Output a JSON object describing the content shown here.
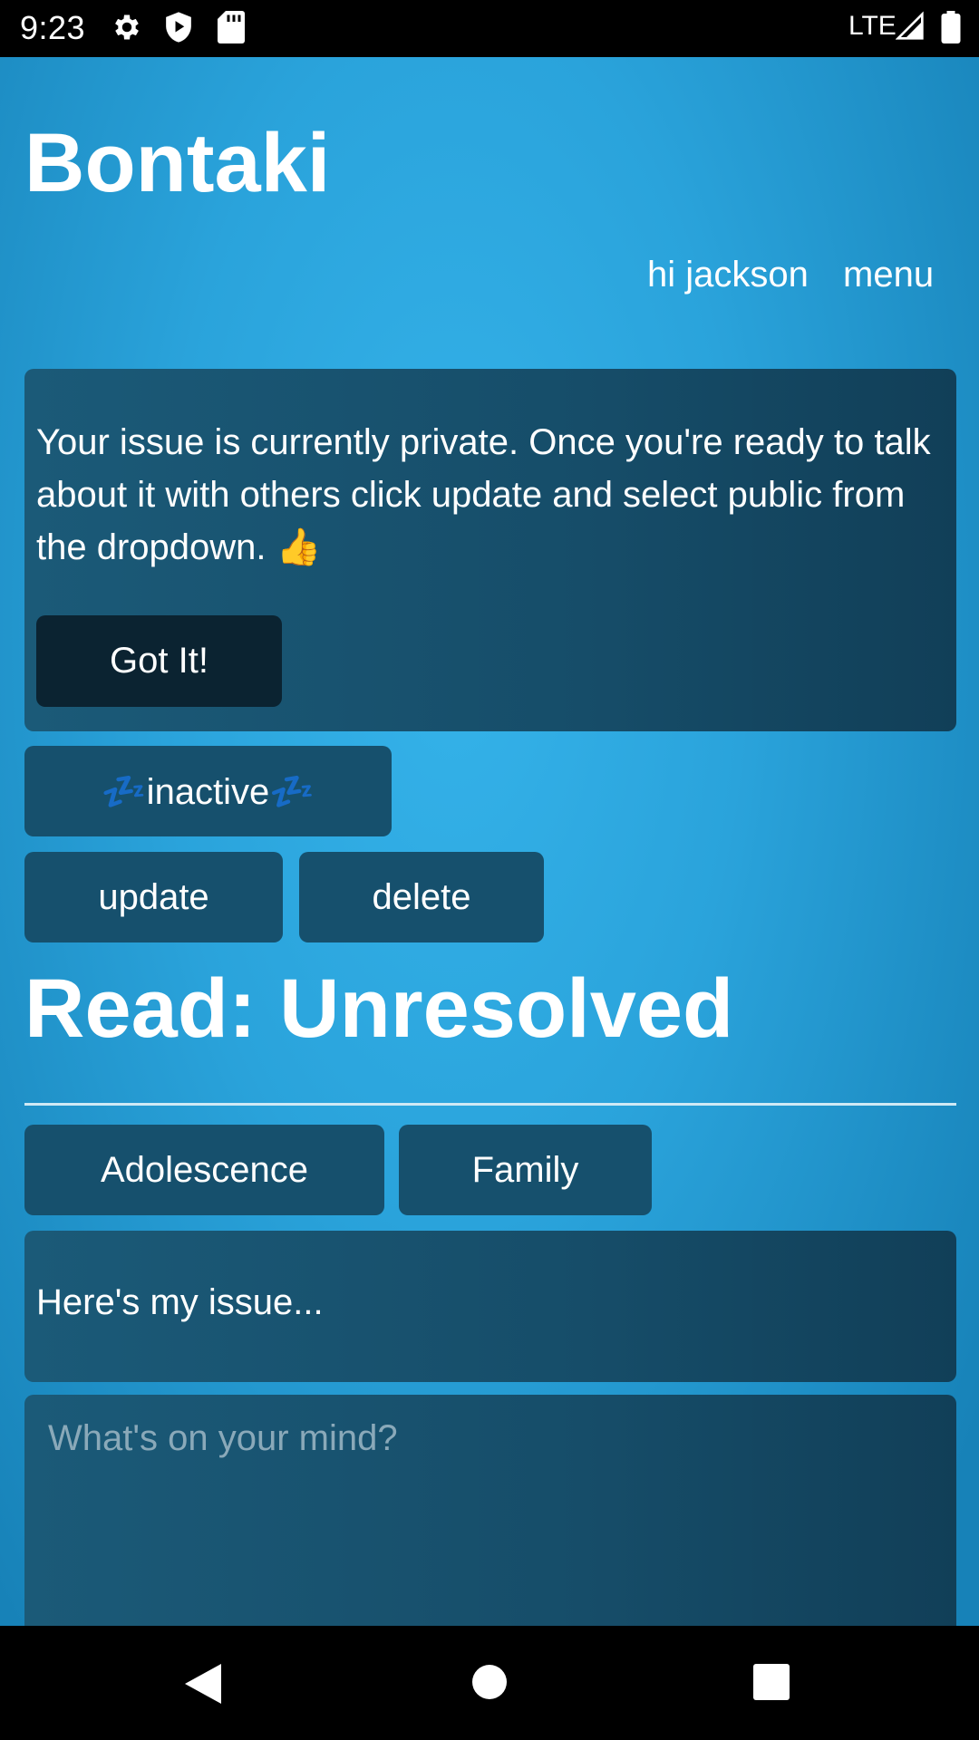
{
  "status_bar": {
    "time": "9:23",
    "network": "LTE",
    "icons": [
      "settings-gear-icon",
      "shield-play-icon",
      "sd-card-icon",
      "signal-icon",
      "battery-icon"
    ]
  },
  "header": {
    "app_title": "Bontaki",
    "greeting": "hi jackson",
    "menu_label": "menu"
  },
  "notice": {
    "text": "Your issue is currently private. Once you're ready to talk about it with others click update and select public from the dropdown. 👍",
    "button_label": "Got It!"
  },
  "status": {
    "badge_label": "💤inactive💤"
  },
  "actions": {
    "update_label": "update",
    "delete_label": "delete"
  },
  "issue": {
    "heading": "Read: Unresolved",
    "tags": [
      "Adolescence",
      "Family"
    ],
    "body": "Here's my issue...",
    "comment_placeholder": "What's on your mind?"
  },
  "nav_bar": {
    "icons": [
      "back-triangle-icon",
      "home-circle-icon",
      "recents-square-icon"
    ]
  },
  "colors": {
    "background_blue": "#2aa3db",
    "card_dark": "#164d69",
    "button_darkest": "#0b2331"
  }
}
